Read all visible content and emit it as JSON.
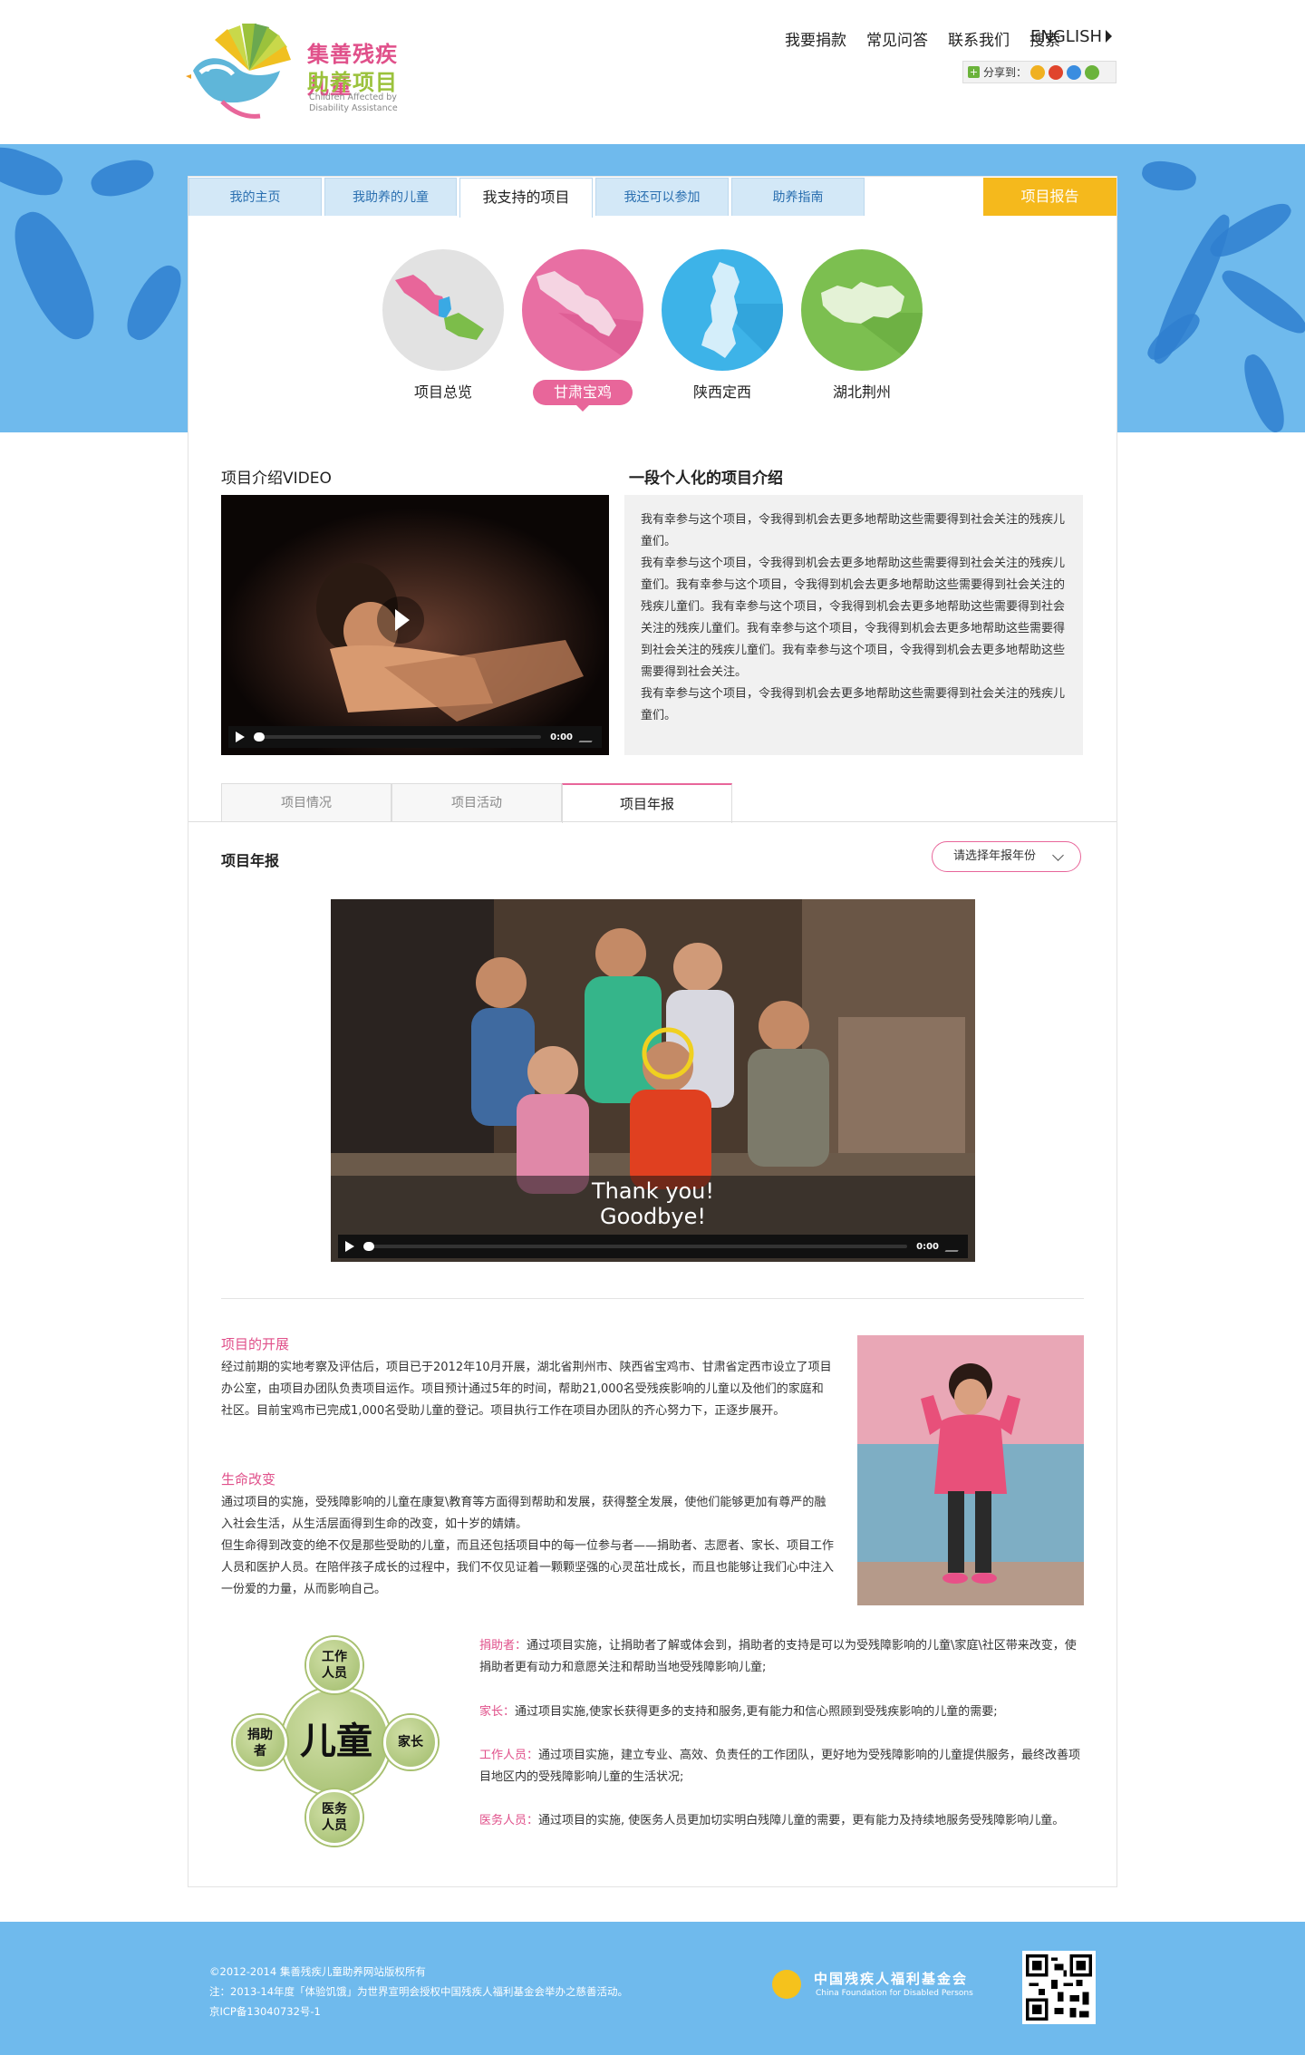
{
  "header": {
    "logo_line1": "集善残疾儿童",
    "logo_line2": "助养项目",
    "logo_en": "Children Affected by Disability Assistance",
    "nav": [
      "我要捐款",
      "常见问答",
      "联系我们",
      "搜索"
    ],
    "english": "ENGLISH",
    "share_label": "分享到："
  },
  "tabs": {
    "items": [
      "我的主页",
      "我助养的儿童",
      "我支持的项目",
      "我还可以参加",
      "助养指南"
    ],
    "active": "我支持的项目",
    "report": "项目报告"
  },
  "regions": {
    "items": [
      "项目总览",
      "甘肃宝鸡",
      "陕西定西",
      "湖北荆州"
    ],
    "selected": "甘肃宝鸡"
  },
  "video_section": {
    "title": "项目介绍VIDEO",
    "time": "0:00"
  },
  "intro": {
    "title": "一段个人化的项目介绍",
    "paragraphs": [
      "我有幸参与这个项目，令我得到机会去更多地帮助这些需要得到社会关注的残疾儿童们。",
      "我有幸参与这个项目，令我得到机会去更多地帮助这些需要得到社会关注的残疾儿童们。我有幸参与这个项目，令我得到机会去更多地帮助这些需要得到社会关注的残疾儿童们。我有幸参与这个项目，令我得到机会去更多地帮助这些需要得到社会关注的残疾儿童们。我有幸参与这个项目，令我得到机会去更多地帮助这些需要得到社会关注的残疾儿童们。我有幸参与这个项目，令我得到机会去更多地帮助这些需要得到社会关注。",
      "我有幸参与这个项目，令我得到机会去更多地帮助这些需要得到社会关注的残疾儿童们。"
    ]
  },
  "subtabs": {
    "items": [
      "项目情况",
      "项目活动",
      "项目年报"
    ],
    "active": "项目年报"
  },
  "annual": {
    "title": "项目年报",
    "year_select": "请选择年报年份",
    "caption_line1": "Thank you!",
    "caption_line2": "Goodbye!",
    "time": "0:00"
  },
  "progress": {
    "title": "项目的开展",
    "text": "经过前期的实地考察及评估后，项目已于2012年10月开展，湖北省荆州市、陕西省宝鸡市、甘肃省定西市设立了项目办公室，由项目办团队负责项目运作。项目预计通过5年的时间，帮助21,000名受残疾影响的儿童以及他们的家庭和社区。目前宝鸡市已完成1,000名受助儿童的登记。项目执行工作在项目办团队的齐心努力下，正逐步展开。"
  },
  "change": {
    "title": "生命改变",
    "text1": "通过项目的实施，受残障影响的儿童在康复\\教育等方面得到帮助和发展，获得整全发展，使他们能够更加有尊严的融入社会生活，从生活层面得到生命的改变，如十岁的婧婧。",
    "text2": "但生命得到改变的绝不仅是那些受助的儿童，而且还包括项目中的每一位参与者——捐助者、志愿者、家长、项目工作人员和医护人员。在陪伴孩子成长的过程中，我们不仅见证着一颗颗坚强的心灵茁壮成长，而且也能够让我们心中注入一份爱的力量，从而影响自己。"
  },
  "diagram": {
    "center": "儿童",
    "top": "工作人员",
    "left": "捐助者",
    "right": "家长",
    "bottom": "医务人员"
  },
  "roles": [
    {
      "name": "捐助者：",
      "text": "通过项目实施，让捐助者了解或体会到，捐助者的支持是可以为受残障影响的儿童\\家庭\\社区带来改变，使捐助者更有动力和意愿关注和帮助当地受残障影响儿童;"
    },
    {
      "name": "家长：",
      "text": "通过项目实施,使家长获得更多的支持和服务,更有能力和信心照顾到受残疾影响的儿童的需要;"
    },
    {
      "name": "工作人员：",
      "text": "通过项目实施，建立专业、高效、负责任的工作团队，更好地为受残障影响的儿童提供服务，最终改善项目地区内的受残障影响儿童的生活状况;"
    },
    {
      "name": "医务人员：",
      "text": "通过项目的实施, 使医务人员更加切实明白残障儿童的需要，更有能力及持续地服务受残障影响儿童。"
    }
  ],
  "footer": {
    "copyright": "©2012-2014 集善残疾儿童助养网站版权所有",
    "note": "注：2013-14年度「体验饥饿」为世界宣明会授权中国残疾人福利基金会举办之慈善活动。",
    "icp": "京ICP备13040732号-1",
    "foundation_cn": "中国残疾人福利基金会",
    "foundation_en": "China Foundation for Disabled Persons"
  },
  "colors": {
    "pink": "#e8669a",
    "blue_band": "#6fbaed",
    "orange": "#f5b91c"
  }
}
